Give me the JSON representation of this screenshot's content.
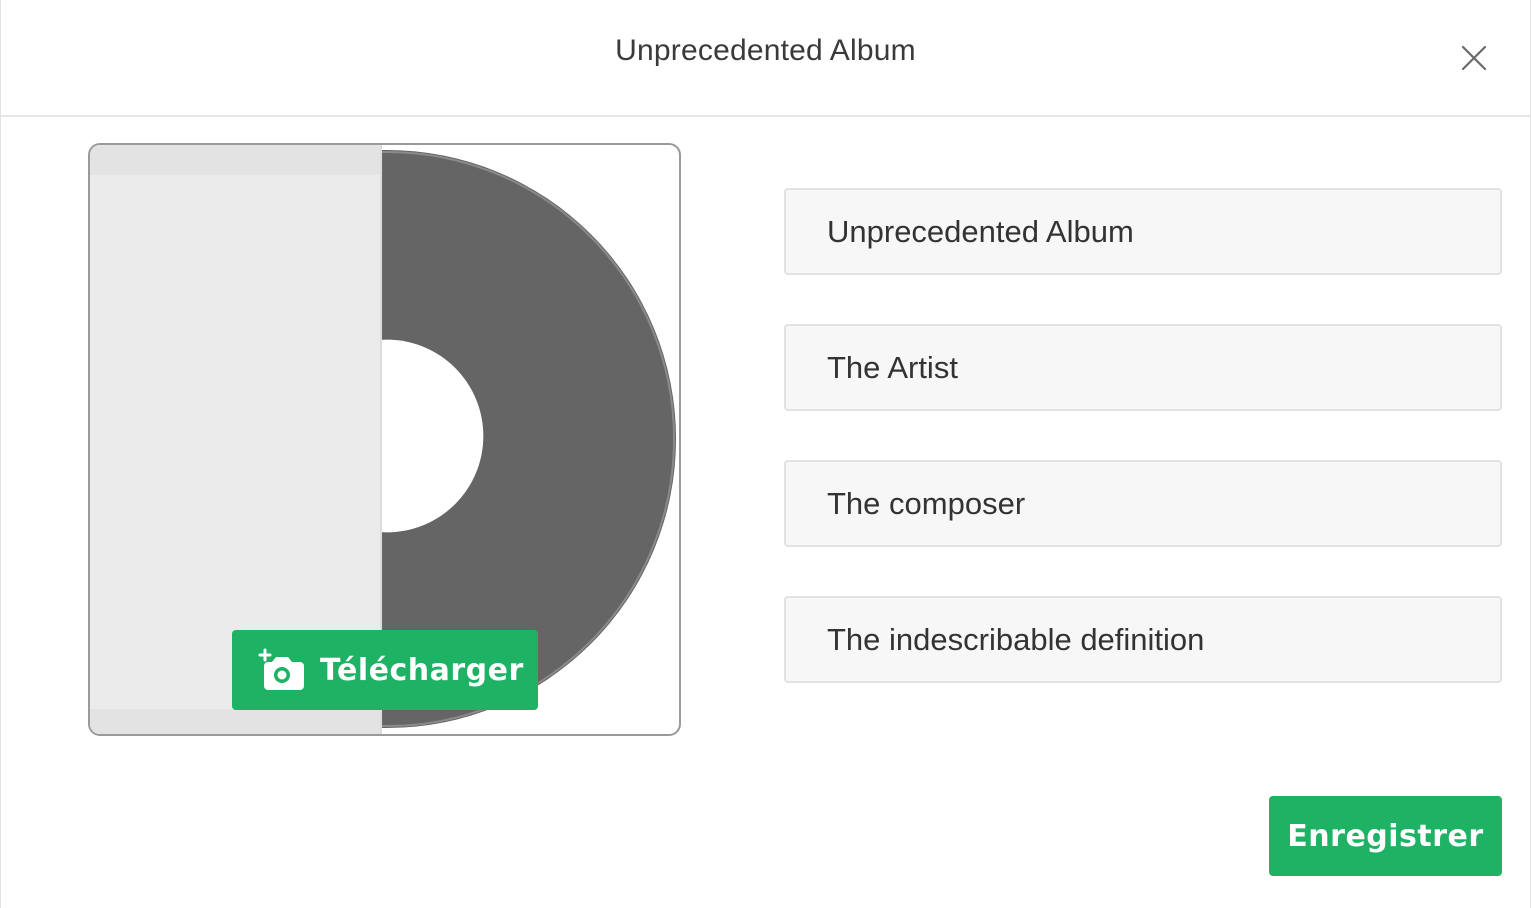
{
  "modal": {
    "title": "Unprecedented Album",
    "close_icon": "close-icon"
  },
  "cover": {
    "image_icon": "vinyl-record-sleeve",
    "upload_label": "Télécharger",
    "upload_icon": "add-photo-camera-icon"
  },
  "form": {
    "title_value": "Unprecedented Album",
    "artist_value": "The Artist",
    "composer_value": "The composer",
    "definition_value": "The indescribable definition"
  },
  "actions": {
    "save_label": "Enregistrer"
  },
  "colors": {
    "accent": "#1db264",
    "text": "#333333",
    "field_bg": "#f7f7f7",
    "border": "#e2e2e2",
    "record": "#656565"
  }
}
